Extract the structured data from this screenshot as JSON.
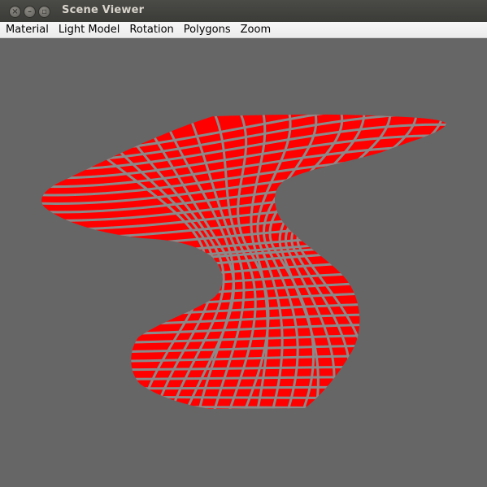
{
  "window": {
    "title": "Scene Viewer",
    "close_glyph": "×",
    "minimize_glyph": "–",
    "maximize_glyph": "▫"
  },
  "menubar": {
    "items": [
      "Material",
      "Light Model",
      "Rotation",
      "Polygons",
      "Zoom"
    ]
  },
  "scene": {
    "background_color": "#666666",
    "surface_color": "#ff0000",
    "wire_color": "#8a8a8a",
    "object": "red twisted vase surface with grey wireframe"
  },
  "icons": {
    "close": "close-icon",
    "minimize": "minimize-icon",
    "maximize": "maximize-icon"
  }
}
